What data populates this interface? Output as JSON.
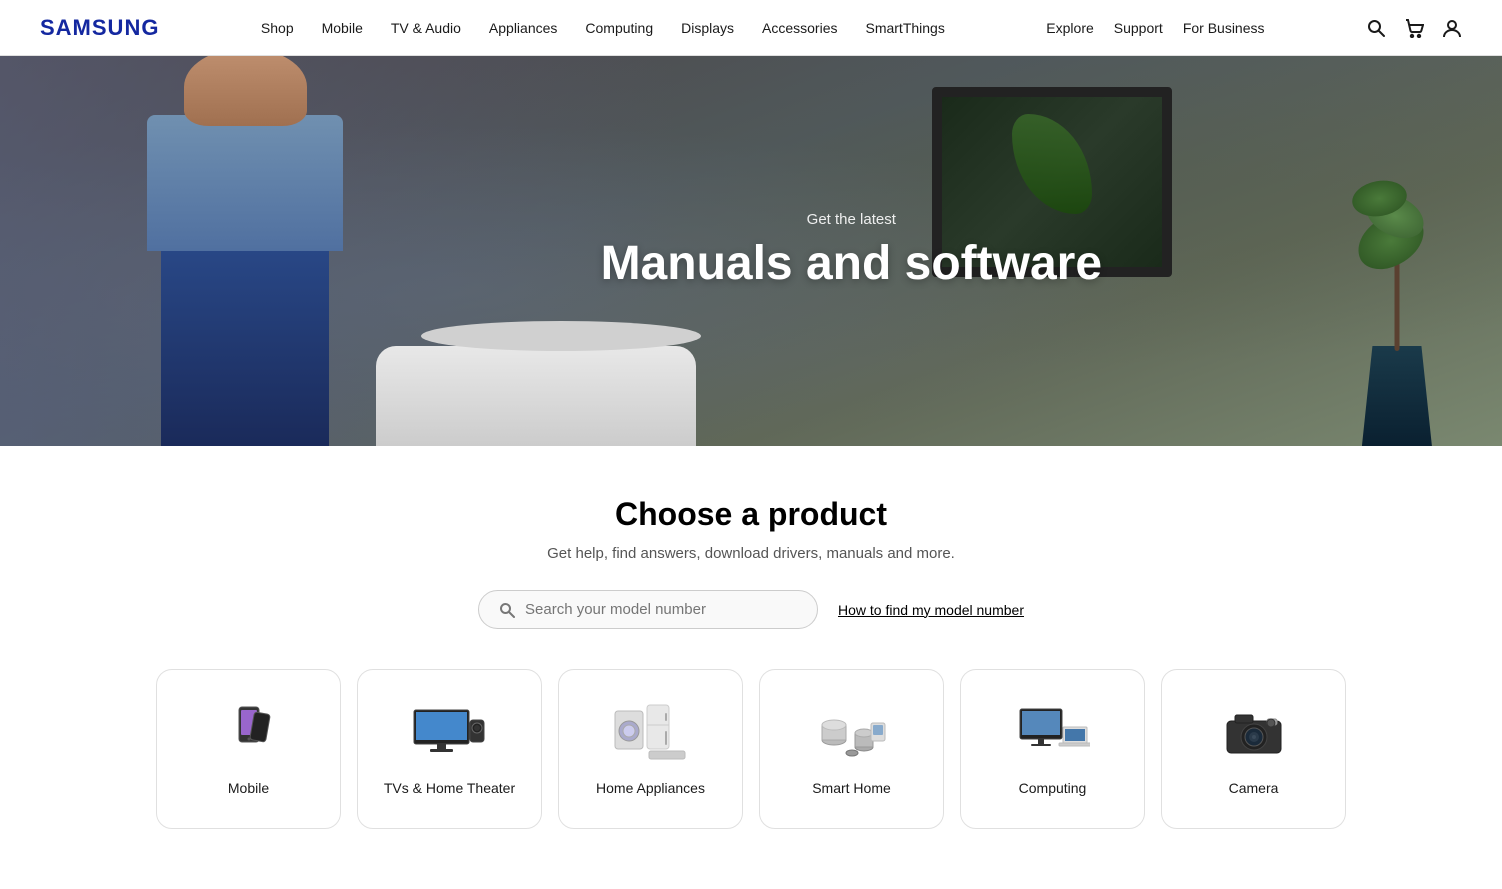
{
  "nav": {
    "logo": "SAMSUNG",
    "links_left": [
      "Shop",
      "Mobile",
      "TV & Audio",
      "Appliances",
      "Computing",
      "Displays",
      "Accessories",
      "SmartThings"
    ],
    "links_right": [
      "Explore",
      "Support",
      "For Business"
    ]
  },
  "hero": {
    "subtitle": "Get the latest",
    "title": "Manuals and software"
  },
  "product_section": {
    "title": "Choose a product",
    "subtitle": "Get help, find answers, download drivers, manuals and more.",
    "search_placeholder": "Search your model number",
    "model_link": "How to find my model number"
  },
  "products": [
    {
      "id": "mobile",
      "label": "Mobile"
    },
    {
      "id": "tvs",
      "label": "TVs & Home Theater"
    },
    {
      "id": "home-appliances",
      "label": "Home Appliances"
    },
    {
      "id": "smart-home",
      "label": "Smart Home"
    },
    {
      "id": "computing",
      "label": "Computing"
    },
    {
      "id": "camera",
      "label": "Camera"
    }
  ]
}
